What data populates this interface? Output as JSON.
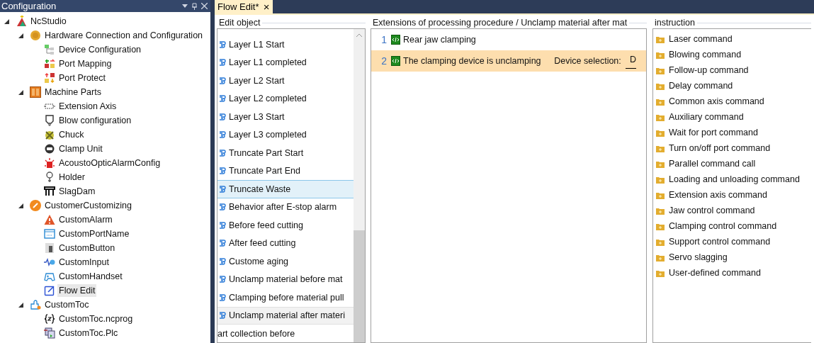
{
  "config_panel": {
    "title": "Configuration",
    "tree": [
      {
        "label": "NcStudio",
        "expanded": true,
        "selected": false,
        "children": [
          {
            "label": "Hardware Connection and Configuration",
            "expanded": true,
            "selected": false,
            "children": [
              {
                "label": "Device Configuration",
                "selected": false
              },
              {
                "label": "Port Mapping",
                "selected": false
              },
              {
                "label": "Port Protect",
                "selected": false
              }
            ]
          },
          {
            "label": "Machine Parts",
            "expanded": true,
            "selected": false,
            "children": [
              {
                "label": "Extension Axis",
                "selected": false
              },
              {
                "label": "Blow configuration",
                "selected": false
              },
              {
                "label": "Chuck",
                "selected": false
              },
              {
                "label": "Clamp Unit",
                "selected": false
              },
              {
                "label": "AcoustoOpticAlarmConfig",
                "selected": false
              },
              {
                "label": "Holder",
                "selected": false
              },
              {
                "label": "SlagDam",
                "selected": false
              }
            ]
          },
          {
            "label": "CustomerCustomizing",
            "expanded": true,
            "selected": false,
            "children": [
              {
                "label": "CustomAlarm",
                "selected": false
              },
              {
                "label": "CustomPortName",
                "selected": false
              },
              {
                "label": "CustomButton",
                "selected": false
              },
              {
                "label": "CustomInput",
                "selected": false
              },
              {
                "label": "CustomHandset",
                "selected": false
              },
              {
                "label": "Flow Edit",
                "selected": true
              }
            ]
          },
          {
            "label": "CustomToc",
            "expanded": true,
            "selected": false,
            "children": [
              {
                "label": "CustomToc.ncprog",
                "selected": false
              },
              {
                "label": "CustomToc.Plc",
                "selected": false
              }
            ]
          }
        ]
      }
    ]
  },
  "tabs": [
    {
      "label": "Flow Edit*",
      "selected": true,
      "close": "×"
    }
  ],
  "edit_object": {
    "title": "Edit object",
    "items": [
      {
        "kind": "item",
        "label": "Layer L1 Start",
        "selected": false,
        "current": false
      },
      {
        "kind": "item",
        "label": "Layer L1 completed",
        "selected": false,
        "current": false
      },
      {
        "kind": "item",
        "label": "Layer L2 Start",
        "selected": false,
        "current": false
      },
      {
        "kind": "item",
        "label": "Layer L2 completed",
        "selected": false,
        "current": false
      },
      {
        "kind": "item",
        "label": "Layer L3 Start",
        "selected": false,
        "current": false
      },
      {
        "kind": "item",
        "label": "Layer L3 completed",
        "selected": false,
        "current": false
      },
      {
        "kind": "item",
        "label": "Truncate Part Start",
        "selected": false,
        "current": false
      },
      {
        "kind": "item",
        "label": "Truncate Part End",
        "selected": false,
        "current": false
      },
      {
        "kind": "item",
        "label": "Truncate Waste",
        "selected": true,
        "current": false
      },
      {
        "kind": "item",
        "label": "Behavior after E-stop alarm",
        "selected": false,
        "current": false
      },
      {
        "kind": "item",
        "label": "Before feed cutting",
        "selected": false,
        "current": false
      },
      {
        "kind": "item",
        "label": "After feed cutting",
        "selected": false,
        "current": false
      },
      {
        "kind": "item",
        "label": "Custome aging",
        "selected": false,
        "current": false
      },
      {
        "kind": "item",
        "label": "Unclamp material before mat",
        "selected": false,
        "current": false
      },
      {
        "kind": "item",
        "label": "Clamping before material pull",
        "selected": false,
        "current": false
      },
      {
        "kind": "item",
        "label": "Unclamp material after materi",
        "selected": false,
        "current": true
      },
      {
        "kind": "header",
        "label": "art collection before",
        "selected": false,
        "current": false
      }
    ]
  },
  "procedure": {
    "title": "Extensions of processing procedure / Unclamp material after mat",
    "lines": [
      {
        "number": "1",
        "text": "Rear jaw clamping",
        "highlighted": false
      },
      {
        "number": "2",
        "text": "The clamping device is unclamping",
        "param_label": "Device selection:",
        "param_value": "D",
        "highlighted": true
      }
    ]
  },
  "instruction": {
    "title": "instruction",
    "items": [
      "Laser command",
      "Blowing command",
      "Follow-up command",
      "Delay command",
      "Common axis command",
      "Auxiliary command",
      "Wait for port command",
      "Turn on/off port command",
      "Parallel command call",
      "Loading and unloading command",
      "Extension axis command",
      "Jaw control command",
      "Clamping control command",
      "Support control command",
      "Servo slagging",
      "User-defined command"
    ]
  }
}
